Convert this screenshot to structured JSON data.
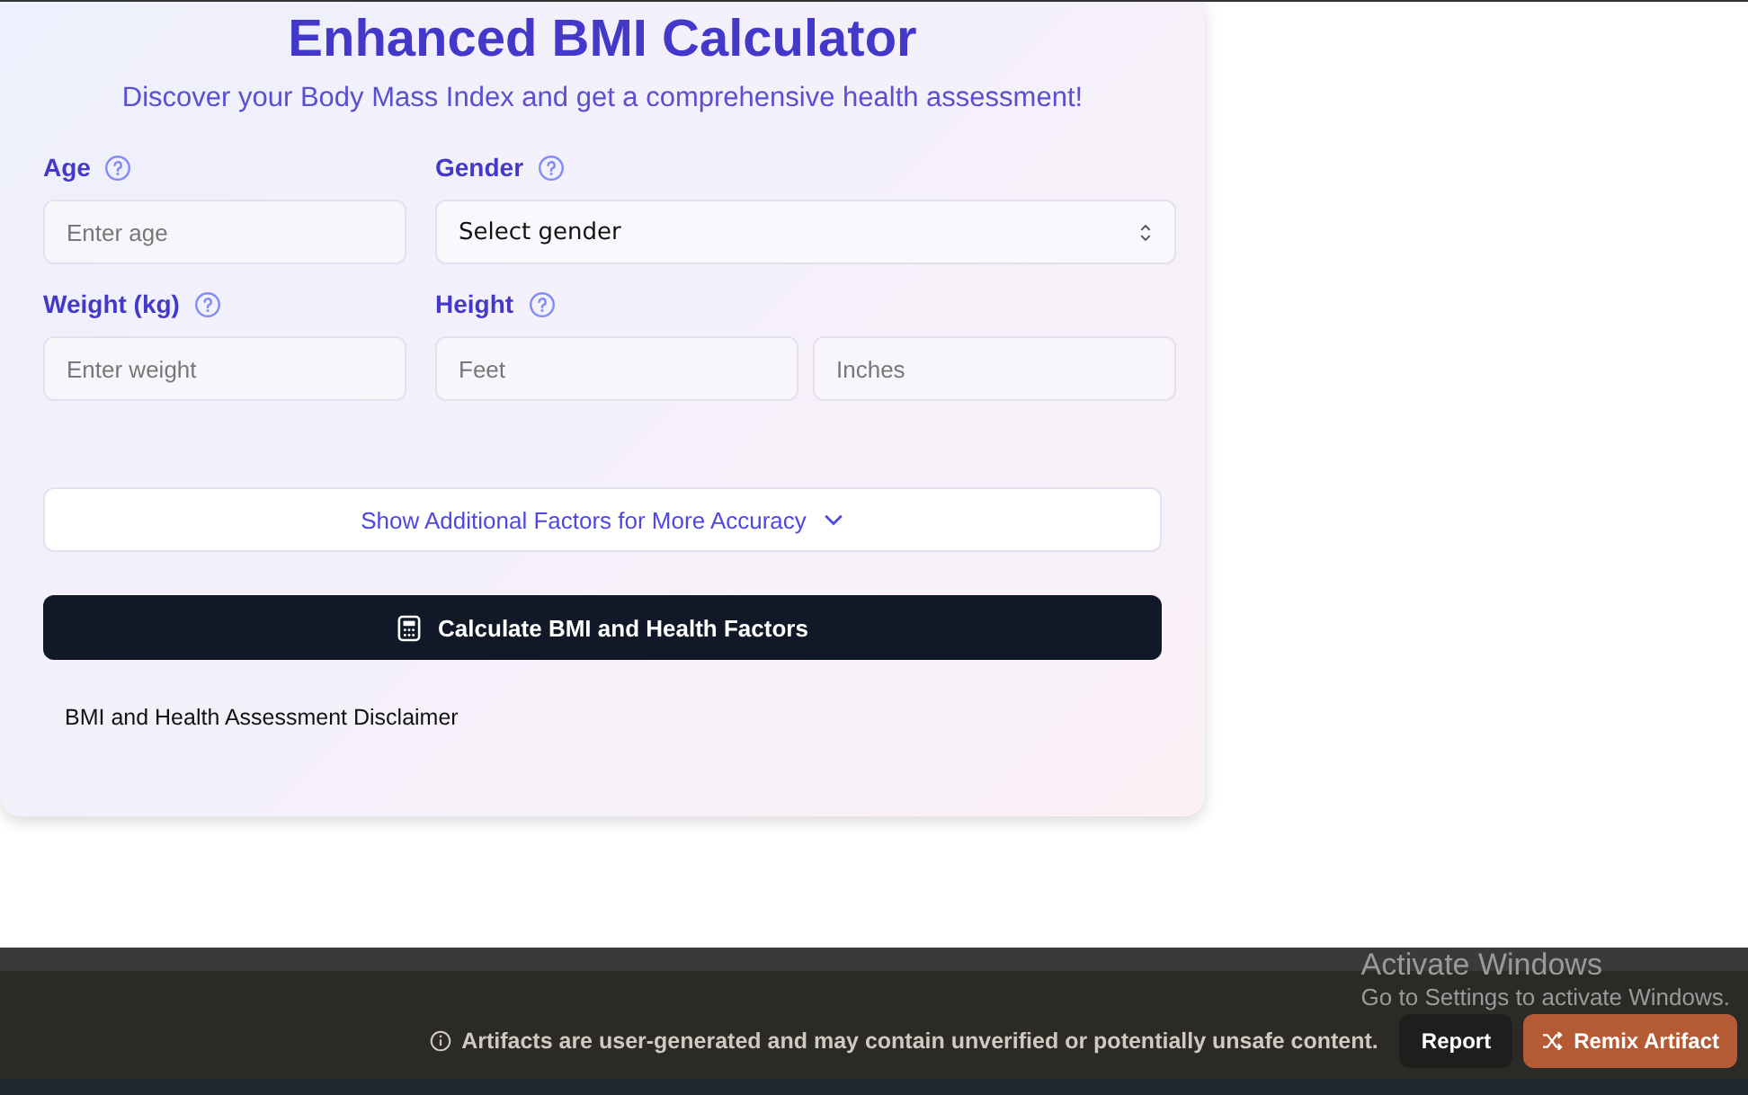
{
  "title": "Enhanced BMI Calculator",
  "subtitle": "Discover your Body Mass Index and get a comprehensive health assessment!",
  "fields": [
    {
      "label": "Age",
      "inputs": [
        {
          "kind": "text",
          "placeholder": "Enter age"
        }
      ]
    },
    {
      "label": "Gender",
      "inputs": [
        {
          "kind": "select",
          "value": "Select gender"
        }
      ]
    },
    {
      "label": "Weight (kg)",
      "inputs": [
        {
          "kind": "text",
          "placeholder": "Enter weight"
        }
      ]
    },
    {
      "label": "Height",
      "inputs": [
        {
          "kind": "text",
          "placeholder": "Feet"
        },
        {
          "kind": "text",
          "placeholder": "Inches"
        }
      ]
    }
  ],
  "toggle": {
    "label": "Show Additional Factors for More Accuracy",
    "expanded": false
  },
  "calculate_button": "Calculate BMI and Health Factors",
  "disclaimer": "BMI and Health Assessment Disclaimer",
  "footer": {
    "notice": "Artifacts are user-generated and may contain unverified or potentially unsafe content.",
    "buttons": [
      "Report",
      "Remix Artifact"
    ]
  },
  "os_overlay": {
    "title": "Activate Windows",
    "message": "Go to Settings to activate Windows."
  }
}
